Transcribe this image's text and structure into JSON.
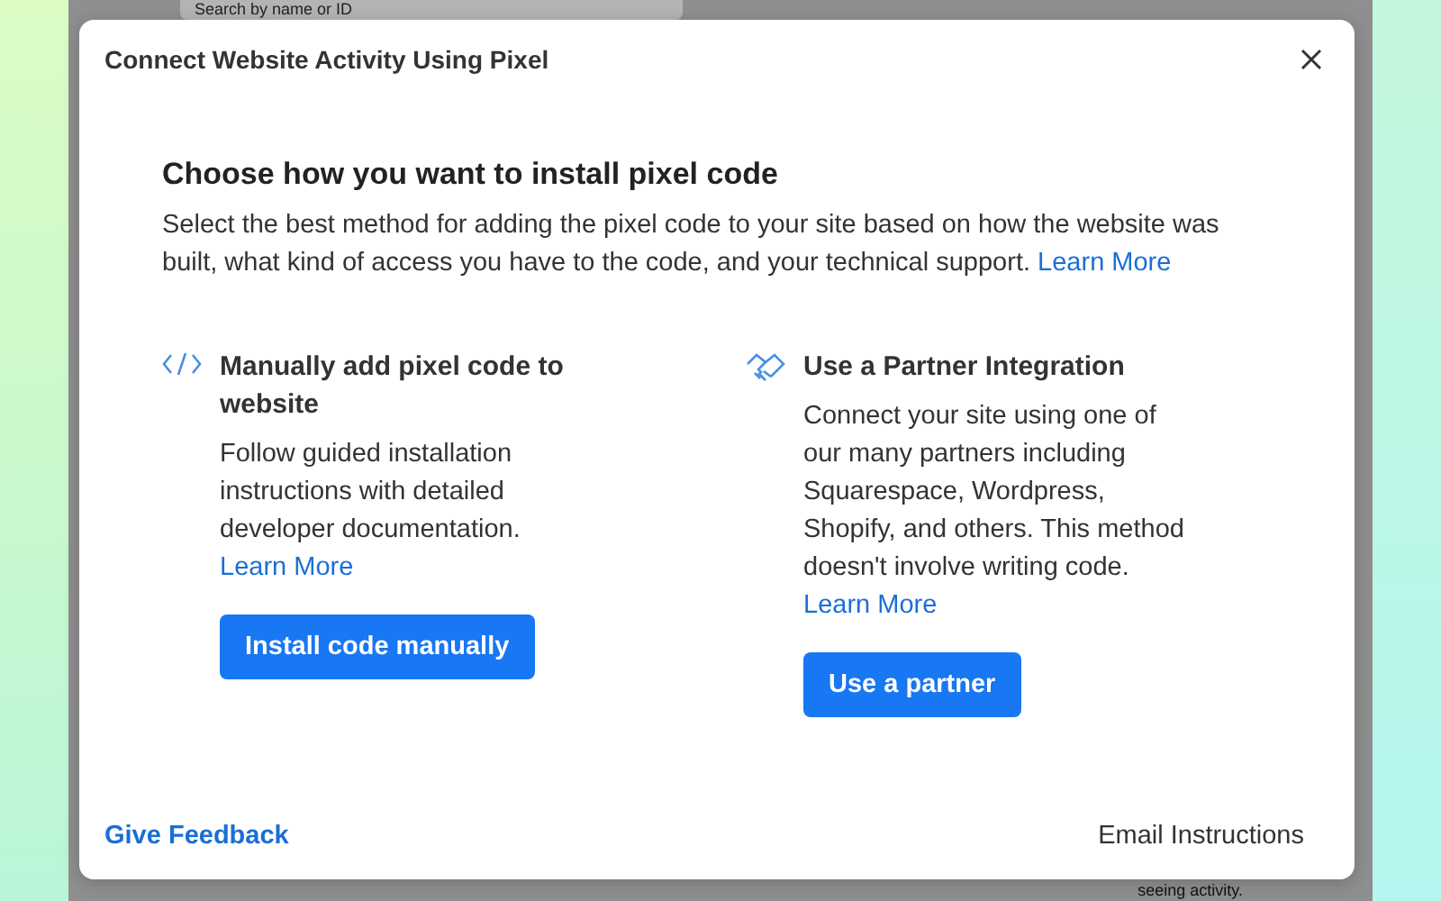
{
  "background_page": {
    "search": {
      "placeholder": "Search by name or ID"
    },
    "text": "seeing activity."
  },
  "dialog": {
    "title": "Connect Website Activity Using Pixel",
    "heading": "Choose how you want to install pixel code",
    "description": "Select the best method for adding the pixel code to your site based on how the website was built, what kind of access you have to the code, and your technical support.",
    "description_link": "Learn More",
    "options": [
      {
        "kind": "code",
        "title": "Manually add pixel code to website",
        "text": "Follow guided installation instructions with detailed developer documentation.",
        "link": "Learn More",
        "button": "Install code manually"
      },
      {
        "kind": "partner",
        "title": "Use a Partner Integration",
        "text": "Connect your site using one of our many partners including Squarespace, Wordpress, Shopify, and others. This method doesn't involve writing code.",
        "link": "Learn More",
        "button": "Use a partner"
      }
    ],
    "footer": {
      "feedback": "Give Feedback",
      "email": "Email Instructions"
    }
  }
}
